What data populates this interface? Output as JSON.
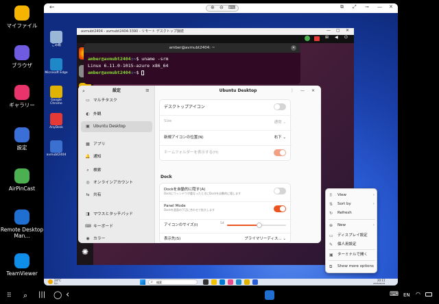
{
  "launcher": {
    "apps": [
      {
        "label": "マイファイル",
        "icon": "folder-icon",
        "color": "#f5b400"
      },
      {
        "label": "ブラウザ",
        "icon": "browser-icon",
        "color": "#6e5be0"
      },
      {
        "label": "ギャラリー",
        "icon": "gallery-icon",
        "color": "#e8336b"
      },
      {
        "label": "設定",
        "icon": "gear-icon",
        "color": "#3a6fd8"
      },
      {
        "label": "AirPinCast",
        "icon": "cast-icon",
        "color": "#4caf50"
      },
      {
        "label": "Remote Desktop Man...",
        "icon": "remote-desktop-icon",
        "color": "#1f6fd1"
      },
      {
        "label": "TeamViewer",
        "icon": "teamviewer-icon",
        "color": "#0e8ee9"
      }
    ]
  },
  "android_taskbar": {
    "language": "EN"
  },
  "window": {
    "rdp_title": "avmubt2404 - avmubt2404:3390 - リモート デスクトップ接続"
  },
  "windows_desktop": {
    "icons": [
      {
        "label": "ごみ箱",
        "color": "#9bb7d8"
      },
      {
        "label": "Microsoft Edge",
        "color": "#1e88c8"
      },
      {
        "label": "Google Chrome",
        "color": "#e0b300"
      },
      {
        "label": "AnyDesk",
        "color": "#e53935"
      },
      {
        "label": "avmubt2404",
        "color": "#3b6fd0"
      }
    ],
    "taskbar": {
      "weather": "24°C",
      "weather_sub": "晴れ",
      "search": "検索",
      "time": "20:11",
      "date": "2025/04/22"
    }
  },
  "ubuntu": {
    "terminal": {
      "title": "amber@avmubt2404: ~",
      "lines": [
        {
          "user": "amber@avmubt2404",
          "path": ":~",
          "cmd": "$ uname -srm"
        },
        {
          "output": "Linux 6.11.0-1015-azure x86_64"
        },
        {
          "user": "amber@avmubt2404",
          "path": ":~",
          "cmd": "$ "
        }
      ]
    },
    "settings": {
      "sidebar_title": "設定",
      "main_title": "Ubuntu Desktop",
      "sidebar": [
        {
          "label": "マルチタスク",
          "icon": "▭"
        },
        {
          "label": "外観",
          "icon": "◐"
        },
        {
          "label": "Ubuntu Desktop",
          "icon": "▣",
          "selected": true
        },
        {
          "label": "アプリ",
          "icon": "▦"
        },
        {
          "label": "通知",
          "icon": "🔔"
        },
        {
          "label": "検索",
          "icon": "⌕"
        },
        {
          "label": "オンラインアカウント",
          "icon": "◎"
        },
        {
          "label": "共有",
          "icon": "⇆"
        },
        {
          "label": "マウスとタッチパッド",
          "icon": "◨"
        },
        {
          "label": "キーボード",
          "icon": "⌨"
        },
        {
          "label": "カラー",
          "icon": "◉"
        }
      ],
      "desktop_icons": {
        "title": "デスクトップアイコン",
        "size_label": "Size",
        "size_value": "通常",
        "position_label": "新規アイコンの位置(N)",
        "position_value": "右下",
        "home_label": "ホームフォルダーを表示する(H)"
      },
      "dock": {
        "section": "Dock",
        "autohide_label": "Dockを自動的に隠す(A)",
        "autohide_sub": "Dockにウィンドウが重なったときにDockを自動的に隠します",
        "panel_label": "Panel Mode",
        "panel_sub": "Dockを画面の下辺に合わせて拡大します",
        "iconsize_label": "アイコンのサイズ(I)",
        "iconsize_value": "54",
        "iconsize_fraction": 0.55,
        "display_label": "表示先(S)",
        "display_value": "プライマリーディス..."
      }
    },
    "context_menu": {
      "items": [
        {
          "label": "View",
          "icon": "⠿",
          "arrow": "›"
        },
        {
          "label": "Sort by",
          "icon": "⇅",
          "arrow": "›"
        },
        {
          "label": "Refresh",
          "icon": "↻",
          "arrow": ""
        },
        {
          "label": "New",
          "icon": "⊕",
          "arrow": "›"
        },
        {
          "label": "ディスプレイ設定",
          "icon": "▭",
          "arrow": ""
        },
        {
          "label": "個人用設定",
          "icon": "✎",
          "arrow": ""
        },
        {
          "label": "ターミナルで開く",
          "icon": "▣",
          "arrow": ""
        },
        {
          "label": "Show more options",
          "icon": "⧉",
          "arrow": ""
        }
      ]
    }
  }
}
